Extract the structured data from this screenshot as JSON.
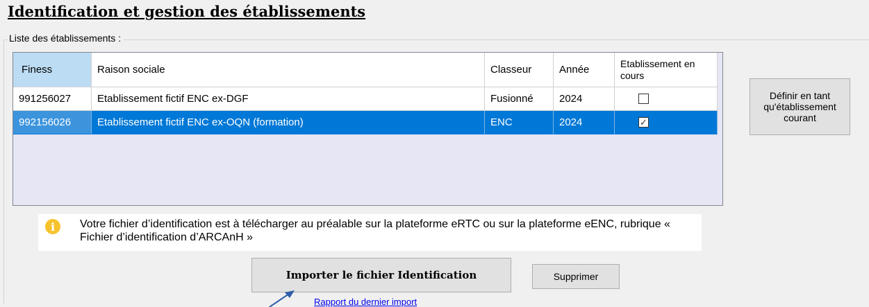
{
  "page": {
    "title": "Identification et gestion des établissements"
  },
  "group": {
    "legend": "Liste des établissements :"
  },
  "grid": {
    "columns": [
      {
        "key": "finess",
        "label": "Finess"
      },
      {
        "key": "raison",
        "label": "Raison sociale"
      },
      {
        "key": "classeur",
        "label": "Classeur"
      },
      {
        "key": "annee",
        "label": "Année"
      },
      {
        "key": "en_cours",
        "label": "Etablissement en cours"
      }
    ],
    "rows": [
      {
        "finess": "991256027",
        "raison": "Etablissement fictif ENC ex-DGF",
        "classeur": "Fusionné",
        "annee": "2024",
        "en_cours": "",
        "selected": false
      },
      {
        "finess": "992156026",
        "raison": "Etablissement fictif ENC ex-OQN (formation)",
        "classeur": "ENC",
        "annee": "2024",
        "en_cours": "✓",
        "selected": true
      }
    ]
  },
  "info": {
    "icon": "info-icon",
    "text": "Votre fichier d’identification est à télécharger au préalable sur la plateforme eRTC ou sur la plateforme eENC, rubrique « Fichier d’identification d’ARCAnH »"
  },
  "buttons": {
    "set_current": "Définir en tant qu'établissement courant",
    "import": "Importer le fichier Identification",
    "delete": "Supprimer"
  },
  "links": {
    "last_import_report": "Rapport du dernier import"
  },
  "colors": {
    "selection": "#0078d7",
    "sorted_header": "#bcdcf4",
    "grid_background": "#e6e6f5",
    "info_icon": "#f7c22c",
    "annotation_arrow": "#2e5ea8"
  }
}
